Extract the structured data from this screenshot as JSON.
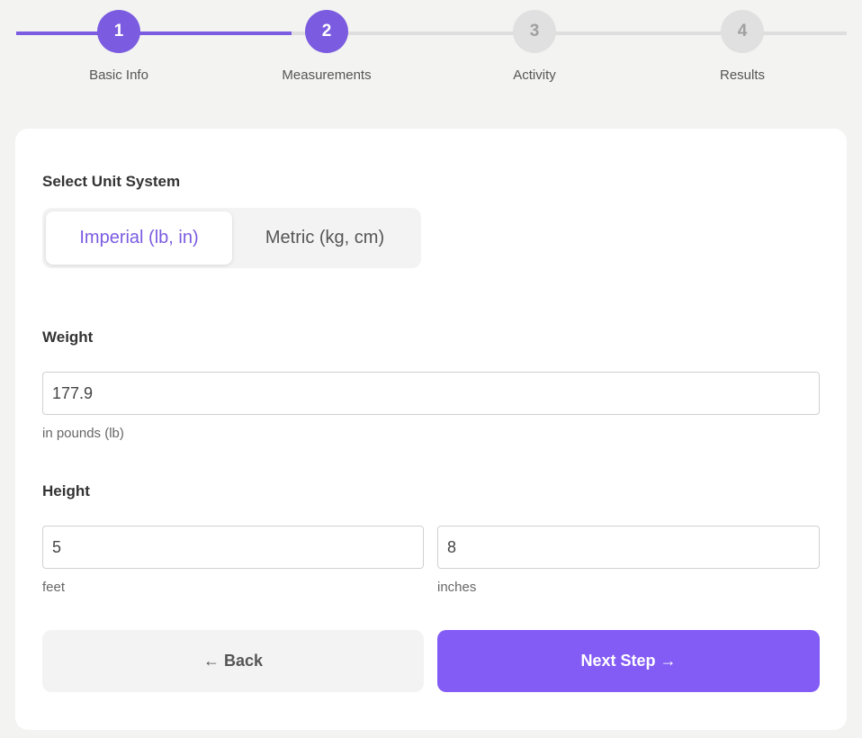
{
  "steps": [
    {
      "number": "1",
      "label": "Basic Info",
      "state": "done"
    },
    {
      "number": "2",
      "label": "Measurements",
      "state": "active"
    },
    {
      "number": "3",
      "label": "Activity",
      "state": "pending"
    },
    {
      "number": "4",
      "label": "Results",
      "state": "pending"
    }
  ],
  "unit_system": {
    "label": "Select Unit System",
    "options": [
      "Imperial (lb, in)",
      "Metric (kg, cm)"
    ],
    "selected": "Imperial (lb, in)"
  },
  "weight": {
    "label": "Weight",
    "value": "177.9",
    "hint": "in pounds (lb)"
  },
  "height": {
    "label": "Height",
    "feet_value": "5",
    "feet_hint": "feet",
    "inches_value": "8",
    "inches_hint": "inches"
  },
  "actions": {
    "back_label": "← Back",
    "next_label": "Next Step →"
  },
  "colors": {
    "accent": "#7b5be0",
    "primary_button": "#835cf5",
    "background": "#f3f4f1"
  }
}
